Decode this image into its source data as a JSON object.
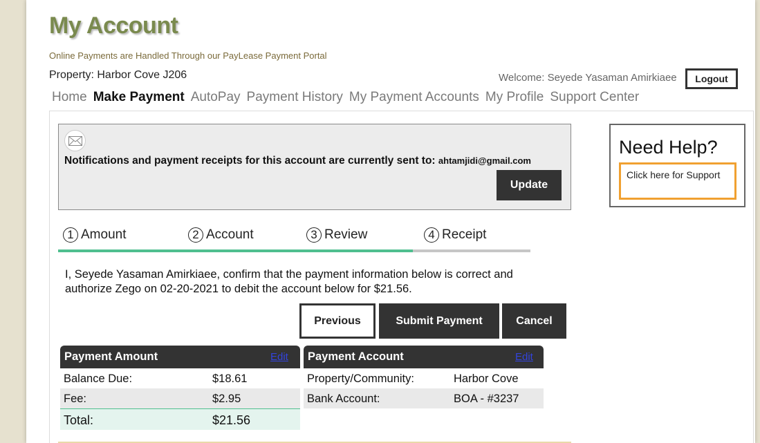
{
  "header": {
    "title": "My Account",
    "subtitle": "Online Payments are Handled Through our PayLease Payment Portal",
    "property": "Property: Harbor Cove J206",
    "welcome": "Welcome: Seyede Yasaman Amirkiaee",
    "logout_label": "Logout"
  },
  "nav": {
    "items": [
      "Home",
      "Make Payment",
      "AutoPay",
      "Payment History",
      "My Payment Accounts",
      "My Profile",
      "Support Center"
    ],
    "active": "Make Payment"
  },
  "notice": {
    "text": "Notifications and payment receipts for this account are currently sent to:",
    "email": "ahtamjidi@gmail.com",
    "update_label": "Update"
  },
  "help": {
    "title": "Need Help?",
    "link": "Click here for Support"
  },
  "steps": [
    {
      "num": "1",
      "label": "Amount"
    },
    {
      "num": "2",
      "label": "Account"
    },
    {
      "num": "3",
      "label": "Review"
    },
    {
      "num": "4",
      "label": "Receipt"
    }
  ],
  "steps_progress": {
    "completed": 3,
    "total": 4
  },
  "confirm_text": "I, Seyede Yasaman Amirkiaee, confirm that the payment information below is correct and authorize Zego on 02-20-2021 to debit the account below for $21.56.",
  "actions": {
    "previous": "Previous",
    "submit": "Submit Payment",
    "cancel": "Cancel"
  },
  "payment_amount": {
    "title": "Payment Amount",
    "edit": "Edit",
    "rows": [
      {
        "label": "Balance Due:",
        "value": "$18.61"
      },
      {
        "label": "Fee:",
        "value": "$2.95"
      }
    ],
    "total_label": "Total:",
    "total_value": "$21.56"
  },
  "payment_account": {
    "title": "Payment Account",
    "edit": "Edit",
    "rows": [
      {
        "label": "Property/Community:",
        "value": "Harbor Cove"
      },
      {
        "label": "Bank Account:",
        "value": "BOA - #3237"
      }
    ]
  },
  "colors": {
    "title_green": "#7a8a4e",
    "progress_done": "#4fbf8f",
    "help_border": "#f0a030",
    "dark_button": "#333333"
  }
}
